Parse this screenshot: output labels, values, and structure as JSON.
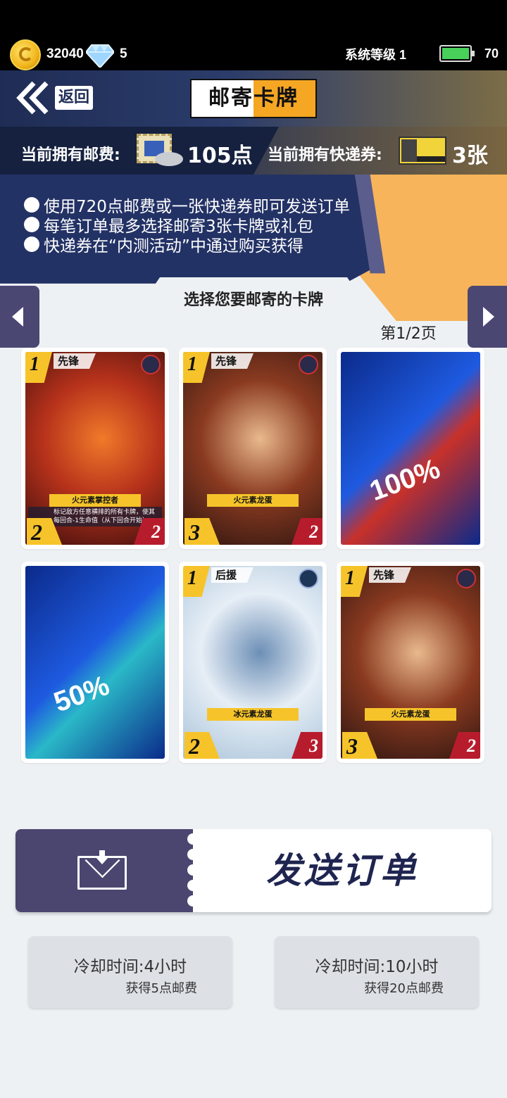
{
  "status": {
    "coins": "32040",
    "gems": "5",
    "system_level": "系统等级 1",
    "energy": "70"
  },
  "header": {
    "back_label": "返回",
    "title": "邮寄卡牌"
  },
  "info": {
    "postage_label": "当前拥有邮费:",
    "postage_value": "105点",
    "express_label": "当前拥有快递券:",
    "express_value": "3张"
  },
  "notice": [
    "使用720点邮费或一张快递券即可发送订单",
    "每笔订单最多选择邮寄3张卡牌或礼包",
    "快递券在“内测活动”中通过购买获得"
  ],
  "selector": {
    "label": "选择您要邮寄的卡牌",
    "page": "第1/2页"
  },
  "cards": [
    {
      "kind": "card",
      "cost": "1",
      "role": "先锋",
      "element": "fire",
      "name": "火元素掌控者",
      "desc": "标记敌方任意横排的所有卡牌，使其每回合-1生命值（从下回合开始）",
      "atk": "2",
      "hp": "2",
      "colors": [
        "#3a0d0d",
        "#b7321b",
        "#f07a2a"
      ]
    },
    {
      "kind": "card",
      "cost": "1",
      "role": "先锋",
      "element": "fire",
      "name": "火元素龙蛋",
      "desc": "",
      "atk": "3",
      "hp": "2",
      "colors": [
        "#2a1410",
        "#8a3a20",
        "#e9b98d"
      ]
    },
    {
      "kind": "pack",
      "pack_text": "100%",
      "colors": [
        "#0b2a8a",
        "#1e5ae0",
        "#c8312a"
      ]
    },
    {
      "kind": "pack",
      "pack_text": "50%",
      "colors": [
        "#0b2a8a",
        "#1e5ae0",
        "#2ab8c8"
      ]
    },
    {
      "kind": "card",
      "cost": "1",
      "role": "后援",
      "element": "ice",
      "name": "冰元素龙蛋",
      "desc": "",
      "atk": "2",
      "hp": "3",
      "colors": [
        "#a9c3d9",
        "#e6eef6",
        "#6d8fb6"
      ]
    },
    {
      "kind": "card",
      "cost": "1",
      "role": "先锋",
      "element": "fire",
      "name": "火元素龙蛋",
      "desc": "",
      "atk": "3",
      "hp": "2",
      "colors": [
        "#2a1410",
        "#8a3a20",
        "#e9b98d"
      ]
    }
  ],
  "send": {
    "label": "发送订单"
  },
  "cooldowns": [
    {
      "title": "冷却时间:4小时",
      "reward": "获得5点邮费"
    },
    {
      "title": "冷却时间:10小时",
      "reward": "获得20点邮费"
    }
  ],
  "colors": {
    "navy": "#233265",
    "orange": "#f7b45a",
    "purple_button": "#4a4670",
    "card_gold": "#f6c42a",
    "hp_red": "#b71c2d"
  }
}
